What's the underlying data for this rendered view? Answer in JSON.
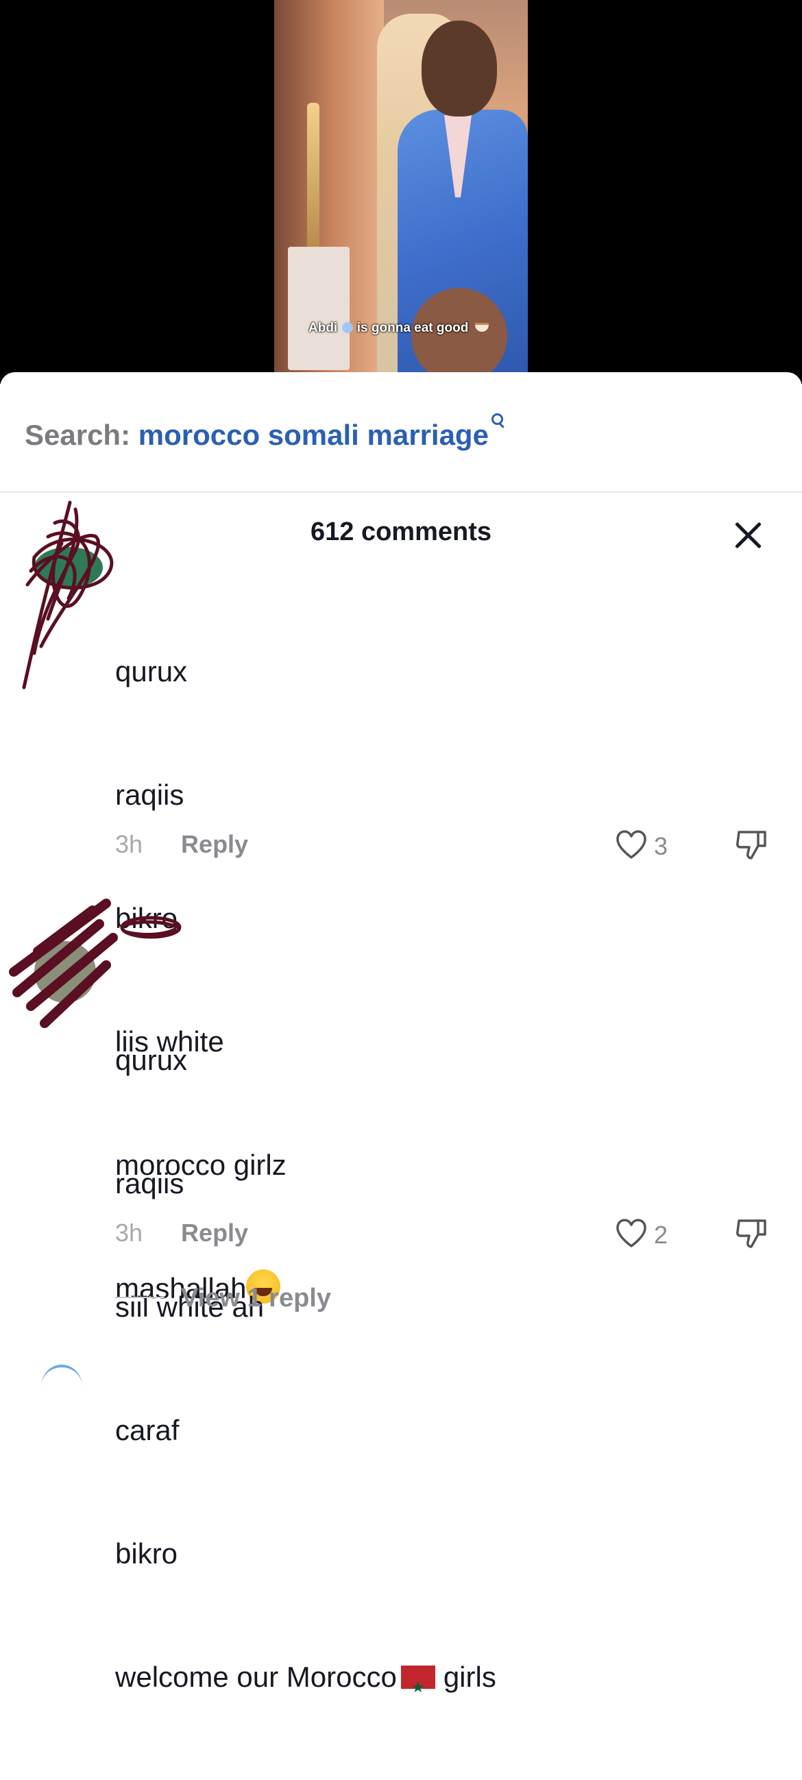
{
  "video": {
    "caption_before": "Abdi",
    "caption_after": "is gonna eat good"
  },
  "search": {
    "label": "Search: ",
    "term": "morocco somali marriage"
  },
  "comments_header": {
    "title": "612 comments"
  },
  "comments": [
    {
      "lines": [
        "qurux",
        "raqiis",
        "bikro",
        "liis white",
        "morocco girlz",
        "mashallah"
      ],
      "time": "3h",
      "reply_label": "Reply",
      "likes": "3"
    },
    {
      "lines": [
        "qurux",
        "raqiis",
        "siil white ah",
        "caraf",
        "bikro"
      ],
      "last_line_start": "welcome our Morocco",
      "last_line_end": "girls",
      "time": "3h",
      "reply_label": "Reply",
      "likes": "2",
      "view_replies": "View 1 reply"
    }
  ],
  "icons": {
    "like": "heart-icon",
    "dislike": "thumbs-down-icon",
    "close": "close-icon",
    "search": "search-icon"
  }
}
